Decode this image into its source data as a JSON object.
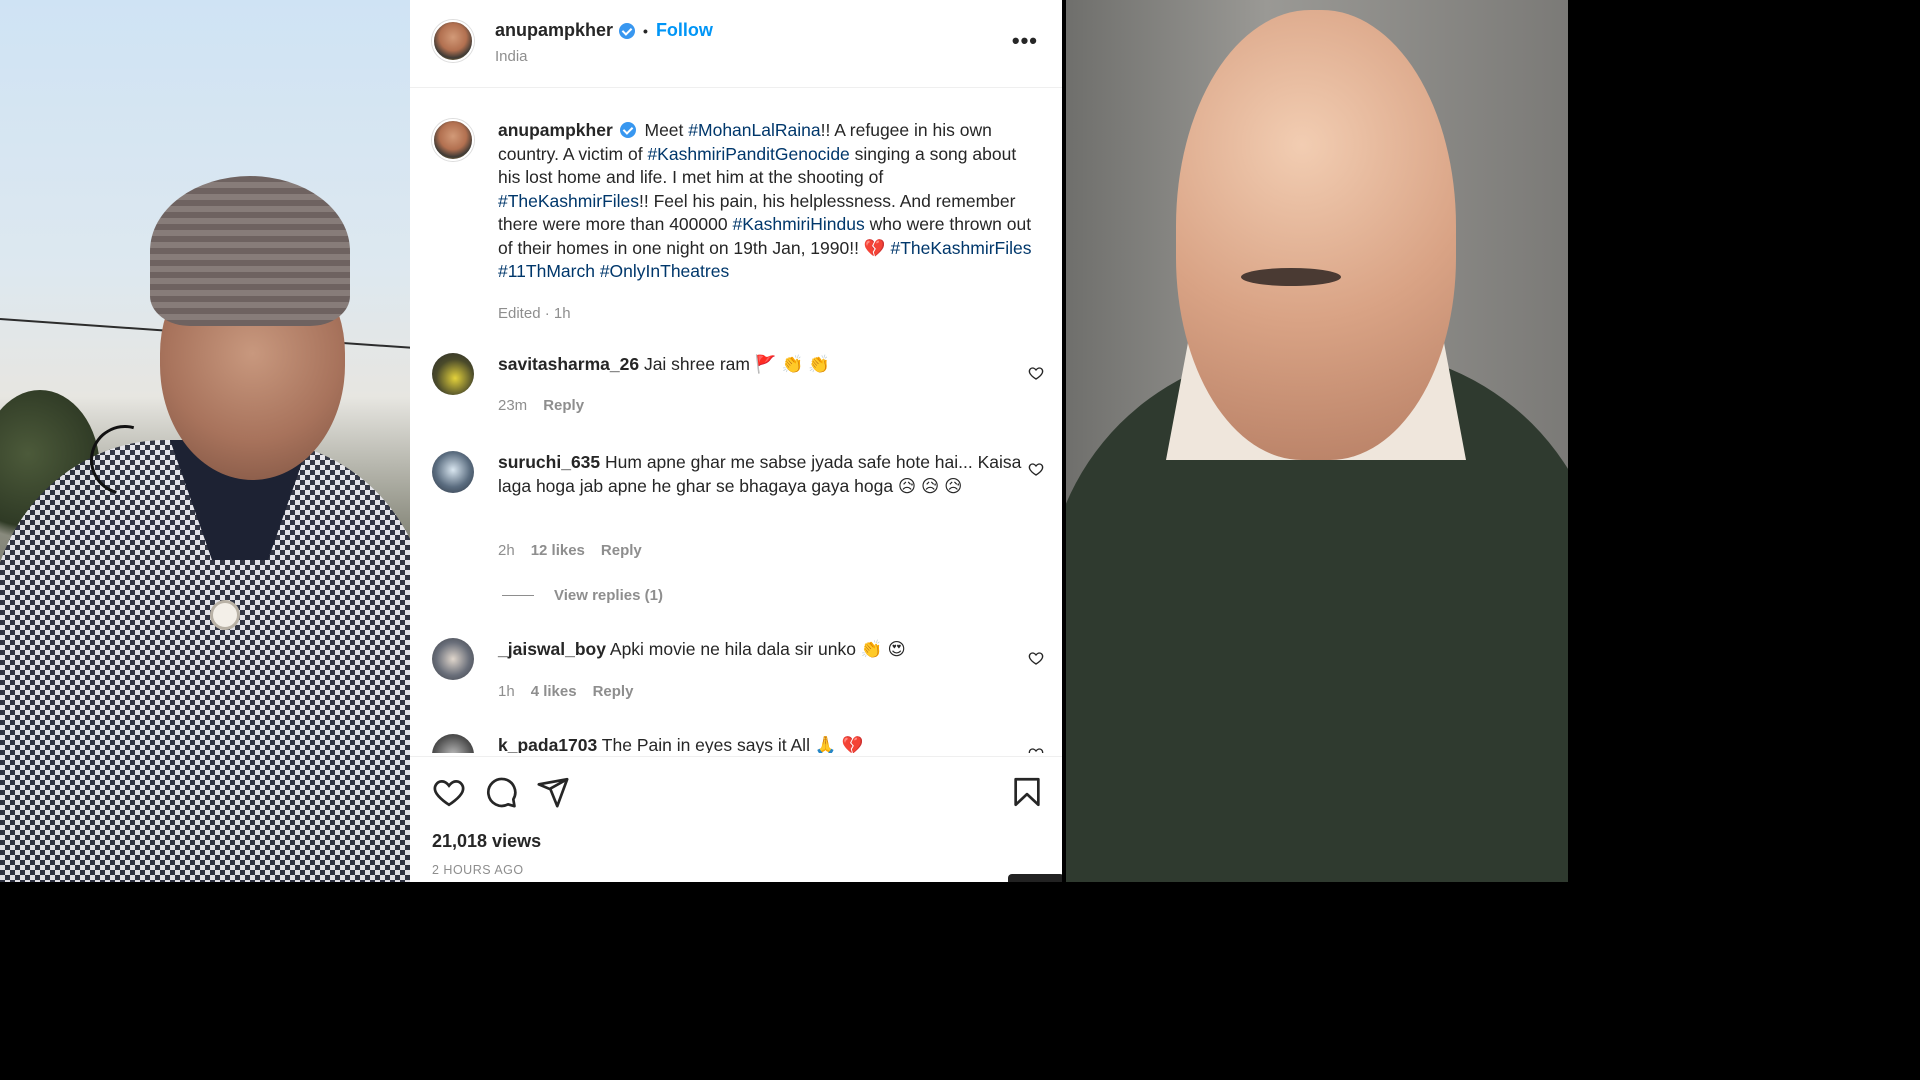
{
  "post": {
    "username": "anupampkher",
    "follow_label": "Follow",
    "separator": "•",
    "location": "India",
    "more_icon": "•••",
    "caption": {
      "username": "anupampkher",
      "text_parts": [
        {
          "t": "Meet "
        },
        {
          "t": "#MohanLalRaina",
          "tag": true
        },
        {
          "t": "!! A refugee in his own country. A victim of "
        },
        {
          "t": "#KashmiriPanditGenocide",
          "tag": true
        },
        {
          "t": " singing a song about his lost home and life. I met him at the shooting of "
        },
        {
          "t": "#TheKashmirFiles",
          "tag": true
        },
        {
          "t": "!! Feel his pain, his helplessness. And remember there were more than 400000 "
        },
        {
          "t": "#KashmiriHindus",
          "tag": true
        },
        {
          "t": " who were thrown out of their homes in one night on 19th Jan, 1990!! 💔 "
        },
        {
          "t": "#TheKashmirFiles",
          "tag": true
        },
        {
          "t": " "
        },
        {
          "t": "#11ThMarch",
          "tag": true
        },
        {
          "t": " "
        },
        {
          "t": "#OnlyInTheatres",
          "tag": true
        }
      ],
      "meta": "Edited · 1h"
    },
    "comments": [
      {
        "user": "savitasharma_26",
        "text": "Jai shree ram 🚩 👏 👏",
        "time": "23m",
        "likes": "",
        "reply": "Reply"
      },
      {
        "user": "suruchi_635",
        "text": "Hum apne ghar me sabse jyada safe hote hai... Kaisa laga hoga jab apne he ghar se bhagaya gaya hoga 😥 😥 😥",
        "time": "2h",
        "likes": "12 likes",
        "reply": "Reply",
        "view_replies": "View replies (1)"
      },
      {
        "user": "_jaiswal_boy",
        "text": "Apki movie ne hila dala sir unko 👏 😍",
        "time": "1h",
        "likes": "4 likes",
        "reply": "Reply"
      },
      {
        "user": "k_pada1703",
        "text": "The Pain in eyes says it All 🙏 💔",
        "time": "",
        "likes": "",
        "reply": ""
      }
    ],
    "views": "21,018 views",
    "time_ago": "2 HOURS AGO"
  },
  "icons": {
    "like": "heart-icon",
    "comment": "comment-icon",
    "share": "share-icon",
    "save": "bookmark-icon",
    "more": "more-options-icon",
    "verified": "verified-badge-icon"
  },
  "colors": {
    "accent": "#0095f6",
    "hashtag": "#00376b",
    "muted": "#8e8e8e",
    "verified": "#3897f0"
  }
}
